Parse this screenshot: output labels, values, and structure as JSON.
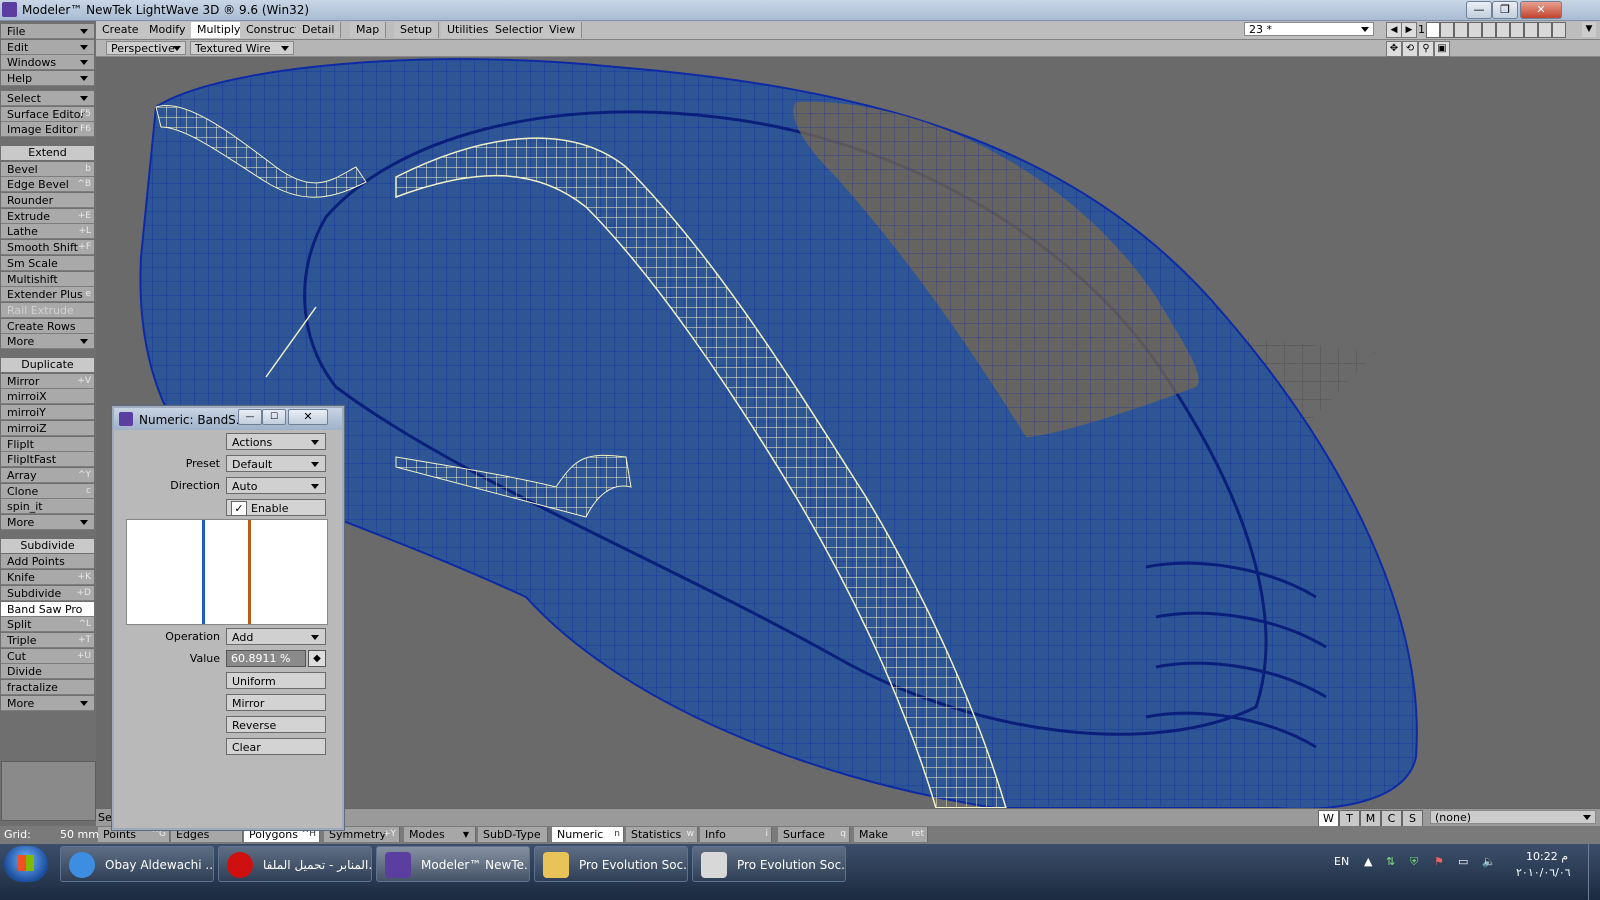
{
  "window": {
    "title": "Modeler™ NewTek LightWave 3D ® 9.6  (Win32)",
    "controls": [
      "—",
      "❐",
      "✕"
    ]
  },
  "tabs": [
    "Create",
    "Modify",
    "Multiply",
    "Construct",
    "Detail",
    "Map",
    "Setup",
    "Utilities",
    "Selection",
    "View"
  ],
  "active_tab": "Multiply",
  "layer_select": "23 *",
  "layer_number": "1",
  "viewport": {
    "view": "Perspective",
    "render": "Textured Wire",
    "nav_icons": [
      "move-view-icon",
      "rotate-view-icon",
      "zoom-view-icon",
      "maximize-view-icon"
    ],
    "surface_none": "(none)",
    "wtmcs": [
      "W",
      "T",
      "M",
      "C",
      "S"
    ],
    "bottom_left": "Se"
  },
  "sidebar": {
    "top_menus": [
      {
        "label": "File"
      },
      {
        "label": "Edit"
      },
      {
        "label": "Windows"
      },
      {
        "label": "Help"
      }
    ],
    "select": {
      "label": "Select"
    },
    "editors": [
      {
        "label": "Surface Editor",
        "shortcut": "F5"
      },
      {
        "label": "Image Editor",
        "shortcut": "F6"
      }
    ],
    "extend_header": "Extend",
    "extend": [
      {
        "label": "Bevel",
        "shortcut": "b"
      },
      {
        "label": "Edge Bevel",
        "shortcut": "^B"
      },
      {
        "label": "Rounder",
        "shortcut": ""
      },
      {
        "label": "Extrude",
        "shortcut": "+E"
      },
      {
        "label": "Lathe",
        "shortcut": "+L"
      },
      {
        "label": "Smooth Shift",
        "shortcut": "+F"
      },
      {
        "label": "Sm Scale",
        "shortcut": ""
      },
      {
        "label": "Multishift",
        "shortcut": ""
      },
      {
        "label": "Extender Plus",
        "shortcut": "e"
      },
      {
        "label": "Rail Extrude",
        "shortcut": ""
      },
      {
        "label": "Create Rows",
        "shortcut": ""
      },
      {
        "label": "More",
        "shortcut": ""
      }
    ],
    "duplicate_header": "Duplicate",
    "duplicate": [
      {
        "label": "Mirror",
        "shortcut": "+V"
      },
      {
        "label": "mirroiX",
        "shortcut": ""
      },
      {
        "label": "mirroiY",
        "shortcut": ""
      },
      {
        "label": "mirroiZ",
        "shortcut": ""
      },
      {
        "label": "FlipIt",
        "shortcut": ""
      },
      {
        "label": "FlipItFast",
        "shortcut": ""
      },
      {
        "label": "Array",
        "shortcut": "^Y"
      },
      {
        "label": "Clone",
        "shortcut": "c"
      },
      {
        "label": "spin_it",
        "shortcut": ""
      },
      {
        "label": "More",
        "shortcut": ""
      }
    ],
    "subdivide_header": "Subdivide",
    "subdivide": [
      {
        "label": "Add Points",
        "shortcut": ""
      },
      {
        "label": "Knife",
        "shortcut": "+K"
      },
      {
        "label": "Subdivide",
        "shortcut": "+D"
      },
      {
        "label": "Band Saw Pro",
        "shortcut": ""
      },
      {
        "label": "Split",
        "shortcut": "^L"
      },
      {
        "label": "Triple",
        "shortcut": "+T"
      },
      {
        "label": "Cut",
        "shortcut": "+U"
      },
      {
        "label": "Divide",
        "shortcut": ""
      },
      {
        "label": "fractalize",
        "shortcut": ""
      },
      {
        "label": "More",
        "shortcut": ""
      }
    ]
  },
  "panel": {
    "title": "Numeric: BandS...",
    "actions": "Actions",
    "preset_label": "Preset",
    "preset": "Default",
    "direction_label": "Direction",
    "direction": "Auto",
    "enable_divide": "Enable divide",
    "enable_divide_checked": true,
    "operation_label": "Operation",
    "operation": "Add",
    "value_label": "Value",
    "value": "60.8911 %",
    "buttons": [
      "Uniform",
      "Mirror",
      "Reverse",
      "Clear"
    ],
    "divide_lines": [
      {
        "position": 0.38,
        "color": "#1f5fb8"
      },
      {
        "position": 0.61,
        "color": "#b85a1a"
      }
    ],
    "colors": {
      "blue_line": "#1f5fb8",
      "orange_line": "#b85a1a"
    }
  },
  "statusbar": {
    "grid_label": "Grid:",
    "grid_value": "50 mm",
    "modes": [
      {
        "label": "Points",
        "shortcut": "^G"
      },
      {
        "label": "Edges",
        "shortcut": ""
      },
      {
        "label": "Polygons",
        "shortcut": "^H"
      }
    ],
    "symmetry": {
      "label": "Symmetry",
      "shortcut": "+Y"
    },
    "modes_menu": "Modes",
    "subd_type": "SubD-Type",
    "numeric": {
      "label": "Numeric",
      "shortcut": "n"
    },
    "statistics": {
      "label": "Statistics",
      "shortcut": "w"
    },
    "info": {
      "label": "Info",
      "shortcut": "i"
    },
    "surface": {
      "label": "Surface",
      "shortcut": "q"
    },
    "make": {
      "label": "Make",
      "shortcut": "ret"
    }
  },
  "taskbar": {
    "items": [
      {
        "label": "Obay Aldewachi ...",
        "icon": "ie-icon",
        "active": false
      },
      {
        "label": "المنابر - تحميل الملفا...",
        "icon": "opera-icon",
        "active": false
      },
      {
        "label": "Modeler™ NewTe...",
        "icon": "lightwave-icon",
        "active": true
      },
      {
        "label": "Pro Evolution Soc...",
        "icon": "folder-icon",
        "active": false
      },
      {
        "label": "Pro Evolution Soc...",
        "icon": "game-icon",
        "active": false
      }
    ],
    "language": "EN",
    "time": "10:22 م",
    "date": "٢٠١٠/٠٦/٠٦"
  },
  "colors": {
    "mesh_blue": "#2a4f8f",
    "mesh_line": "#0d2aa6",
    "selection": "#f2f2c8",
    "patch": "#7a6a50"
  }
}
